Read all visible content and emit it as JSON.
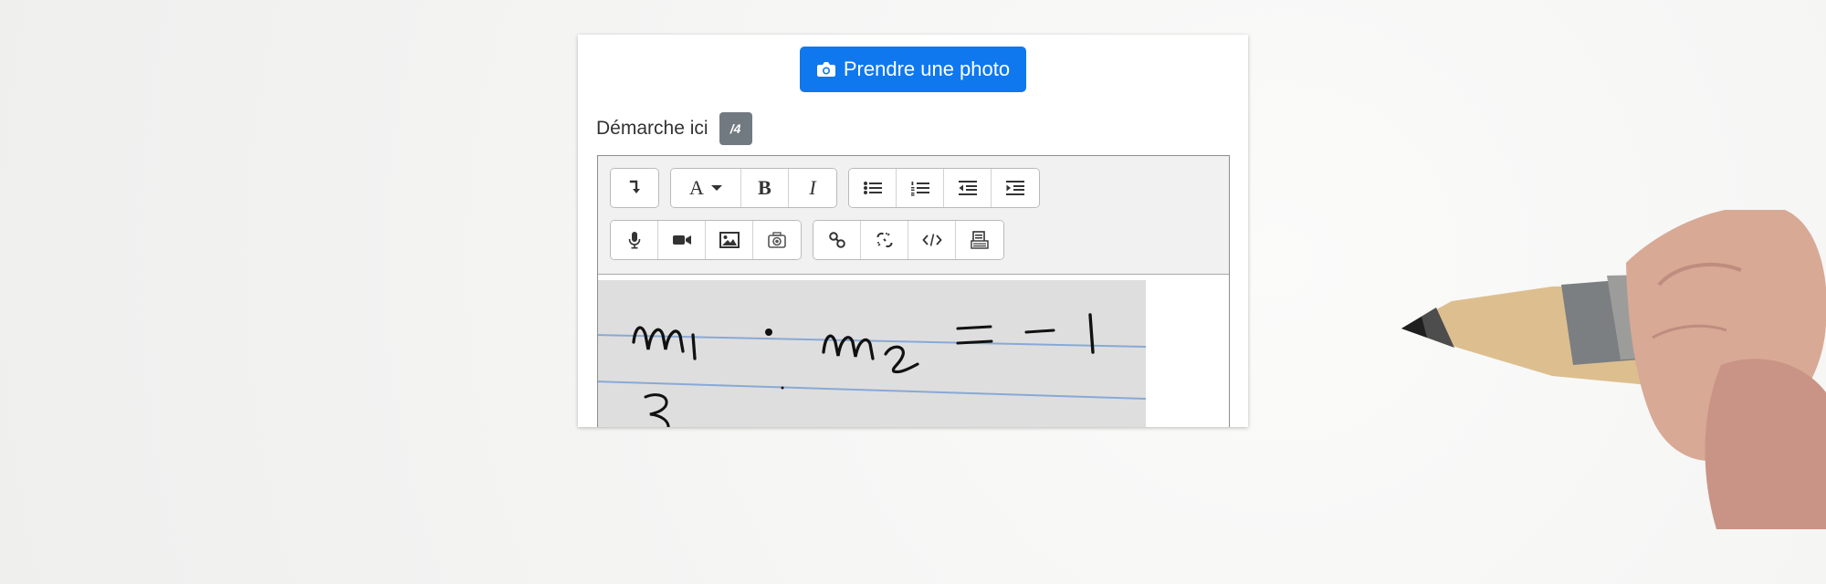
{
  "photo_button": {
    "label": "Prendre une photo",
    "icon": "camera-icon"
  },
  "field": {
    "label": "Démarche ici",
    "score_badge": "/4"
  },
  "toolbar": {
    "row1": [
      [
        "undo-redo-icon"
      ],
      [
        "font-icon",
        "bold-icon",
        "italic-icon"
      ],
      [
        "bullet-list-icon",
        "numbered-list-icon",
        "outdent-icon",
        "indent-icon"
      ]
    ],
    "row2": [
      [
        "microphone-icon",
        "video-camera-icon",
        "image-icon",
        "camera-icon"
      ],
      [
        "link-icon",
        "unlink-icon",
        "code-icon",
        "clean-paste-icon"
      ]
    ],
    "font_label": "A",
    "bold_label": "B",
    "italic_label": "I"
  },
  "content": {
    "type": "handwritten-image"
  },
  "colors": {
    "primary": "#0f78ef",
    "badge": "#727a81",
    "toolbar_bg": "#f1f1f1"
  }
}
